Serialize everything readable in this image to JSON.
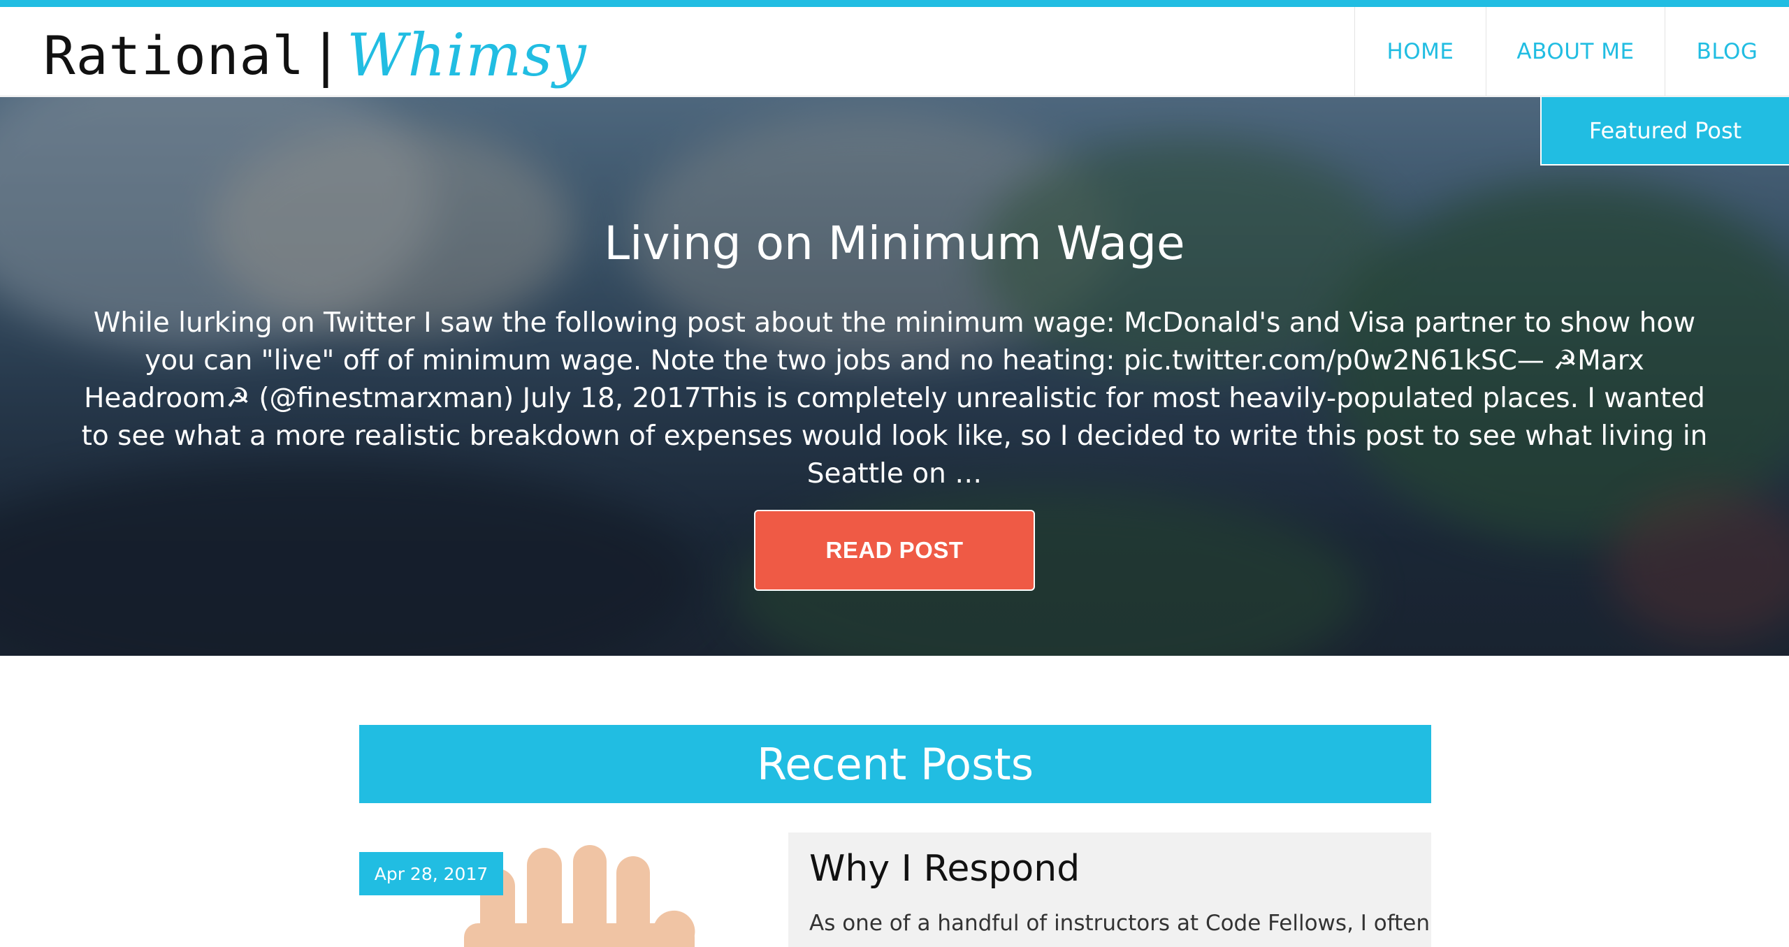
{
  "header": {
    "logo_primary": "Rational",
    "logo_separator": "|",
    "logo_secondary": "Whimsy",
    "nav": {
      "home": "HOME",
      "about": "ABOUT ME",
      "blog": "BLOG"
    }
  },
  "featured": {
    "tab_label": "Featured Post",
    "title": "Living on Minimum Wage",
    "excerpt": "While lurking on Twitter I saw the following post about the minimum wage: McDonald's and Visa partner to show how you can \"live\" off of minimum wage. Note the two jobs and no heating: pic.twitter.com/p0w2N61kSC— ☭Marx Headroom☭ (@finestmarxman) July 18, 2017This is completely unrealistic for most heavily-populated places. I wanted to see what a more realistic breakdown of expenses would look like, so I decided to write this post to see what living in Seattle on …",
    "button_label": "READ POST"
  },
  "recent": {
    "heading": "Recent Posts",
    "posts": [
      {
        "date": "Apr 28, 2017",
        "title": "Why I Respond",
        "excerpt": "As one of a handful of instructors at Code Fellows, I often"
      }
    ]
  },
  "colors": {
    "accent": "#21bde2",
    "button": "#ef5a45",
    "card_bg": "#f1f1f1"
  }
}
